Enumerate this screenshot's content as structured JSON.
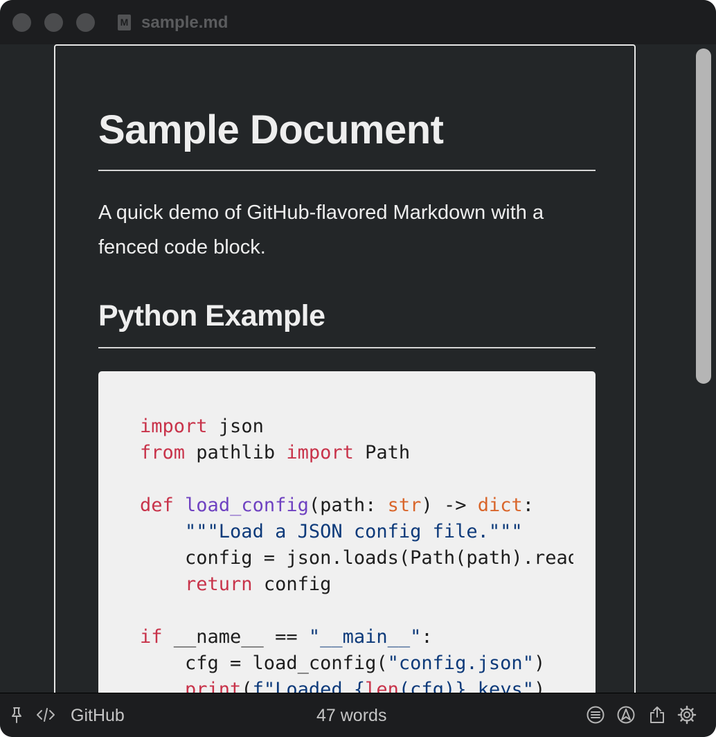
{
  "window": {
    "title": "sample.md",
    "file_icon_letter": "M"
  },
  "document": {
    "h1": "Sample Document",
    "paragraph": "A quick demo of GitHub-flavored Markdown with a fenced code block.",
    "h2": "Python Example",
    "code_lines": [
      [
        {
          "t": "import",
          "c": "kw"
        },
        {
          "t": " json",
          "c": ""
        }
      ],
      [
        {
          "t": "from",
          "c": "kw"
        },
        {
          "t": " pathlib ",
          "c": ""
        },
        {
          "t": "import",
          "c": "kw"
        },
        {
          "t": " Path",
          "c": ""
        }
      ],
      [],
      [
        {
          "t": "def",
          "c": "kw"
        },
        {
          "t": " ",
          "c": ""
        },
        {
          "t": "load_config",
          "c": "fn"
        },
        {
          "t": "(path: ",
          "c": ""
        },
        {
          "t": "str",
          "c": "ty"
        },
        {
          "t": ") -> ",
          "c": ""
        },
        {
          "t": "dict",
          "c": "ty"
        },
        {
          "t": ":",
          "c": ""
        }
      ],
      [
        {
          "t": "    ",
          "c": ""
        },
        {
          "t": "\"\"\"Load a JSON config file.\"\"\"",
          "c": "st"
        }
      ],
      [
        {
          "t": "    config = json.loads(Path(path).read_text())",
          "c": ""
        }
      ],
      [
        {
          "t": "    ",
          "c": ""
        },
        {
          "t": "return",
          "c": "kw"
        },
        {
          "t": " config",
          "c": ""
        }
      ],
      [],
      [
        {
          "t": "if",
          "c": "kw"
        },
        {
          "t": " __name__ == ",
          "c": ""
        },
        {
          "t": "\"__main__\"",
          "c": "st"
        },
        {
          "t": ":",
          "c": ""
        }
      ],
      [
        {
          "t": "    cfg = load_config(",
          "c": ""
        },
        {
          "t": "\"config.json\"",
          "c": "st"
        },
        {
          "t": ")",
          "c": ""
        }
      ],
      [
        {
          "t": "    ",
          "c": ""
        },
        {
          "t": "print",
          "c": "kw"
        },
        {
          "t": "(",
          "c": ""
        },
        {
          "t": "f\"Loaded {",
          "c": "st"
        },
        {
          "t": "len",
          "c": "kw"
        },
        {
          "t": "(cfg)} keys\"",
          "c": "st"
        },
        {
          "t": ")",
          "c": ""
        }
      ]
    ]
  },
  "statusbar": {
    "style_label": "GitHub",
    "word_count": "47 words",
    "icons": [
      "pin-icon",
      "code-icon",
      "outline-icon",
      "navigate-icon",
      "share-icon",
      "gear-icon"
    ]
  },
  "colors": {
    "keyword": "#c8334a",
    "function": "#6f42c1",
    "type": "#d9662b",
    "string": "#0d3a7a",
    "background": "#232628"
  }
}
